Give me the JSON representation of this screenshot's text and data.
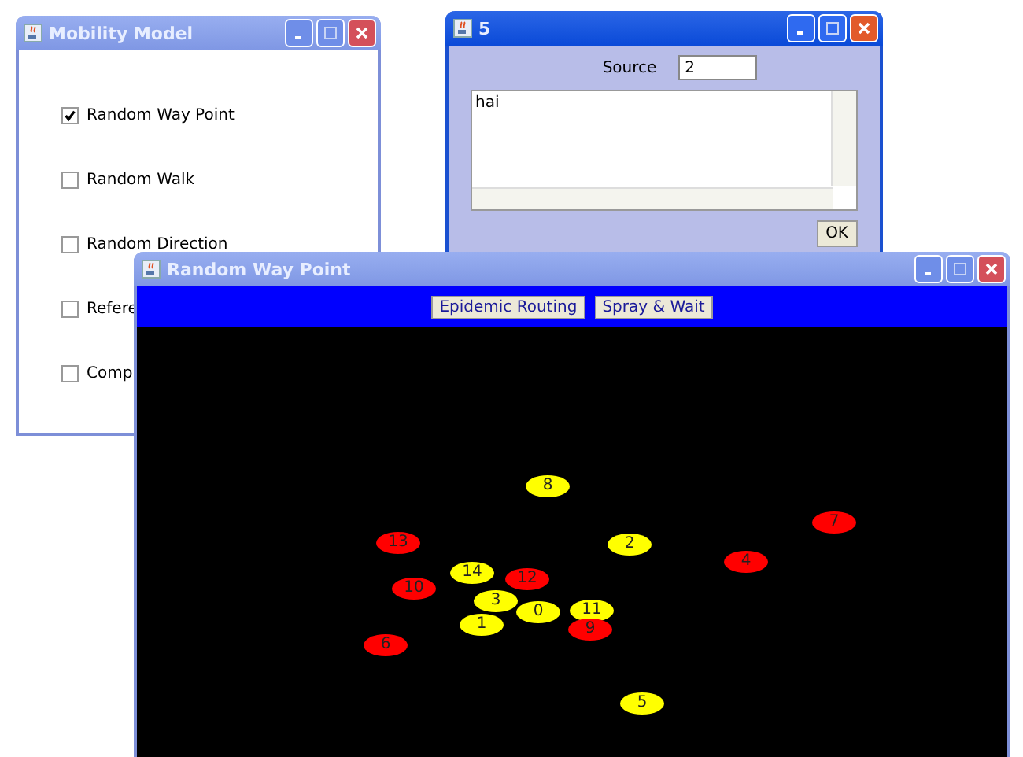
{
  "windows": [
    {
      "kind": "options",
      "title": "Mobility Model",
      "options": [
        {
          "label": "Random Way Point",
          "checked": true
        },
        {
          "label": "Random Walk",
          "checked": false
        },
        {
          "label": "Random Direction",
          "checked": false
        },
        {
          "label": "Refere",
          "checked": false
        },
        {
          "label": "Comp",
          "checked": false
        }
      ]
    },
    {
      "kind": "dialog",
      "title": "5",
      "source_label": "Source",
      "source_value": "2",
      "log": "hai",
      "ok": "OK"
    },
    {
      "kind": "simulation",
      "title": "Random Way Point",
      "buttons": [
        "Epidemic Routing",
        "Spray & Wait"
      ],
      "nodes": [
        {
          "label": "8",
          "color": "#ffff00"
        },
        {
          "label": "7",
          "color": "#ff0000"
        },
        {
          "label": "13",
          "color": "#ff0000"
        },
        {
          "label": "2",
          "color": "#ffff00"
        },
        {
          "label": "4",
          "color": "#ff0000"
        },
        {
          "label": "14",
          "color": "#ffff00"
        },
        {
          "label": "12",
          "color": "#ff0000"
        },
        {
          "label": "10",
          "color": "#ff0000"
        },
        {
          "label": "3",
          "color": "#ffff00"
        },
        {
          "label": "0",
          "color": "#ffff00"
        },
        {
          "label": "11",
          "color": "#ffff00"
        },
        {
          "label": "1",
          "color": "#ffff00"
        },
        {
          "label": "9",
          "color": "#ff0000"
        },
        {
          "label": "6",
          "color": "#ff0000"
        },
        {
          "label": "5",
          "color": "#ffff00"
        }
      ]
    }
  ]
}
